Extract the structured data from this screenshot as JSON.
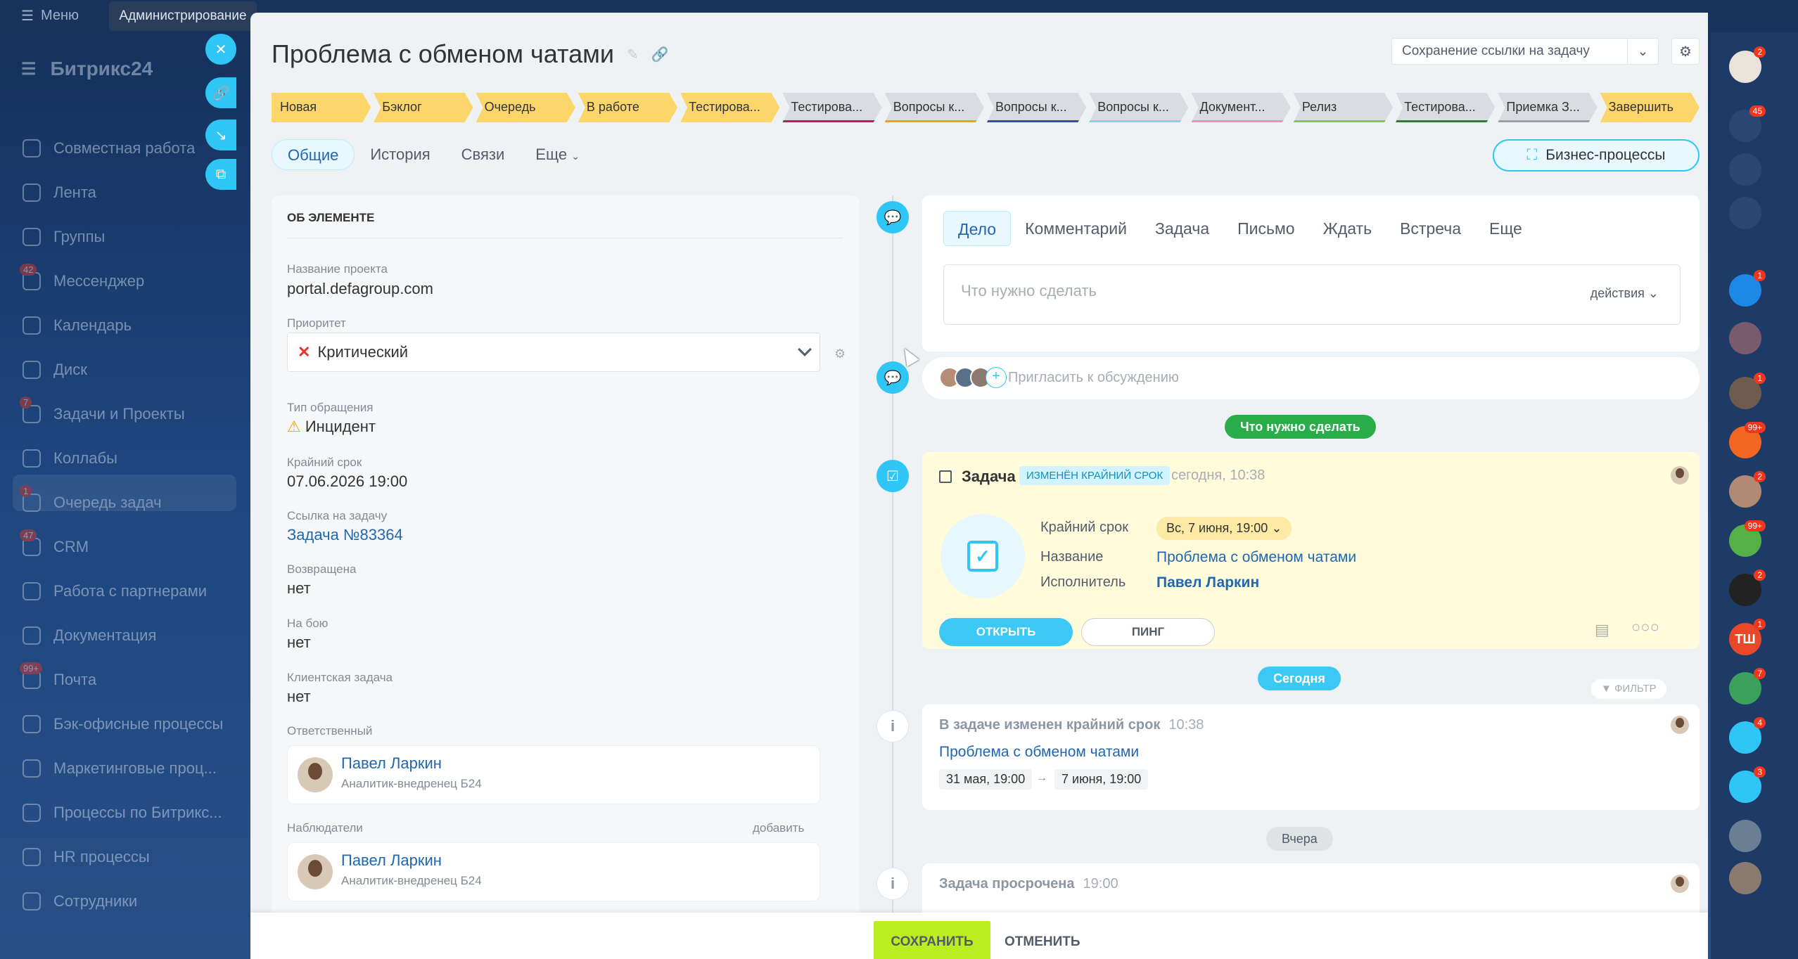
{
  "topbar": {
    "menu_label": "Меню",
    "admin_tab": "Администрирование"
  },
  "brand": {
    "name": "Битрикс24"
  },
  "left_nav": [
    {
      "label": "Совместная работа",
      "badge": ""
    },
    {
      "label": "Лента",
      "badge": ""
    },
    {
      "label": "Группы",
      "badge": ""
    },
    {
      "label": "Мессенджер",
      "badge": "42"
    },
    {
      "label": "Календарь",
      "badge": ""
    },
    {
      "label": "Диск",
      "badge": ""
    },
    {
      "label": "Задачи и Проекты",
      "badge": "7"
    },
    {
      "label": "Коллабы",
      "badge": ""
    },
    {
      "label": "Очередь задач",
      "badge": "1"
    },
    {
      "label": "CRM",
      "badge": "47"
    },
    {
      "label": "Работа с партнерами",
      "badge": ""
    },
    {
      "label": "Документация",
      "badge": ""
    },
    {
      "label": "Почта",
      "badge": "99+"
    },
    {
      "label": "Бэк-офисные процессы",
      "badge": ""
    },
    {
      "label": "Маркетинговые проц...",
      "badge": ""
    },
    {
      "label": "Процессы по Битрикс...",
      "badge": ""
    },
    {
      "label": "HR процессы",
      "badge": ""
    },
    {
      "label": "Сотрудники",
      "badge": ""
    }
  ],
  "page": {
    "title": "Проблема с обменом чатами"
  },
  "save_link": {
    "label": "Сохранение ссылки на задачу"
  },
  "stages": [
    {
      "label": "Новая",
      "state": "act",
      "color": "#fdd66b"
    },
    {
      "label": "Бэклог",
      "state": "act",
      "color": "#fdd66b"
    },
    {
      "label": "Очередь",
      "state": "act",
      "color": "#fdd66b"
    },
    {
      "label": "В работе",
      "state": "act",
      "color": "#fdd66b"
    },
    {
      "label": "Тестирова...",
      "state": "act",
      "color": "#fdd66b"
    },
    {
      "label": "Тестирова...",
      "state": "inact",
      "color": "#c2185b"
    },
    {
      "label": "Вопросы к...",
      "state": "inact",
      "color": "#f0a30a"
    },
    {
      "label": "Вопросы к...",
      "state": "inact",
      "color": "#3949ab"
    },
    {
      "label": "Вопросы к...",
      "state": "inact",
      "color": "#7dd3f0"
    },
    {
      "label": "Документ...",
      "state": "inact",
      "color": "#f48fb1"
    },
    {
      "label": "Релиз",
      "state": "inact",
      "color": "#8bc34a"
    },
    {
      "label": "Тестирова...",
      "state": "inact",
      "color": "#2e7d32"
    },
    {
      "label": "Приемка З...",
      "state": "inact",
      "color": "#9e9e9e"
    },
    {
      "label": "Завершить",
      "state": "act",
      "color": "#fdd66b"
    }
  ],
  "tabs": [
    "Общие",
    "История",
    "Связи",
    "Еще"
  ],
  "bp_button": "Бизнес-процессы",
  "element": {
    "heading": "ОБ ЭЛЕМЕНТЕ",
    "project_label": "Название проекта",
    "project_value": "portal.defagroup.com",
    "priority_label": "Приоритет",
    "priority_value": "Критический",
    "type_label": "Тип обращения",
    "type_value": "Инцидент",
    "deadline_label": "Крайний срок",
    "deadline_value": "07.06.2026 19:00",
    "task_link_label": "Ссылка на задачу",
    "task_link_value": "Задача №83364",
    "returned_label": "Возвращена",
    "returned_value": "нет",
    "prod_label": "На бою",
    "prod_value": "нет",
    "client_label": "Клиентская задача",
    "client_value": "нет",
    "responsible_label": "Ответственный",
    "observers_label": "Наблюдатели",
    "add_label": "добавить",
    "person_name": "Павел Ларкин",
    "person_role": "Аналитик-внедренец Б24"
  },
  "editor": {
    "tabs": [
      "Дело",
      "Комментарий",
      "Задача",
      "Письмо",
      "Ждать",
      "Встреча",
      "Еще"
    ],
    "placeholder": "Что нужно сделать",
    "actions": "действия"
  },
  "invite": {
    "placeholder": "Пригласить к обсуждению"
  },
  "todo_pill": "Что нужно сделать",
  "task": {
    "title": "Задача",
    "badge": "ИЗМЕНЁН КРАЙНИЙ СРОК",
    "time": "сегодня, 10:38",
    "deadline_label": "Крайний срок",
    "deadline_value": "Вс, 7 июня, 19:00",
    "name_label": "Название",
    "name_value": "Проблема с обменом чатами",
    "assignee_label": "Исполнитель",
    "assignee_value": "Павел Ларкин",
    "open_btn": "ОТКРЫТЬ",
    "ping_btn": "ПИНГ"
  },
  "today_pill": "Сегодня",
  "filter": "ФИЛЬТР",
  "hist1": {
    "title": "В задаче изменен крайний срок",
    "time": "10:38",
    "link": "Проблема с обменом чатами",
    "from": "31 мая, 19:00",
    "to": "7 июня, 19:00"
  },
  "yesterday_pill": "Вчера",
  "hist2": {
    "title": "Задача просрочена",
    "time": "19:00"
  },
  "footer": {
    "save": "СОХРАНИТЬ",
    "cancel": "ОТМЕНИТЬ"
  },
  "right_bar": [
    {
      "label": "",
      "badge": "2",
      "color": "#e9e3dc"
    },
    {
      "label": "",
      "badge": "45",
      "color": "#2a4773"
    },
    {
      "label": "",
      "badge": "",
      "color": "#2a4773"
    },
    {
      "label": "",
      "badge": "",
      "color": "#2a4773"
    },
    {
      "label": "",
      "badge": "1",
      "color": "#1e88e5"
    },
    {
      "label": "",
      "badge": "",
      "color": "#7a5b6e"
    },
    {
      "label": "",
      "badge": "1",
      "color": "#6f5a4e"
    },
    {
      "label": "",
      "badge": "99+",
      "color": "#f26522"
    },
    {
      "label": "",
      "badge": "2",
      "color": "#b08a72"
    },
    {
      "label": "",
      "badge": "99+",
      "color": "#55b047"
    },
    {
      "label": "",
      "badge": "2",
      "color": "#222"
    },
    {
      "label": "ТШ",
      "badge": "1",
      "color": "#e8472a"
    },
    {
      "label": "",
      "badge": "7",
      "color": "#3aa05c"
    },
    {
      "label": "",
      "badge": "4",
      "color": "#2fc6f6"
    },
    {
      "label": "",
      "badge": "3",
      "color": "#2fc6f6"
    },
    {
      "label": "",
      "badge": "",
      "color": "#6a7f94"
    },
    {
      "label": "",
      "badge": "",
      "color": "#8a7a70"
    }
  ]
}
